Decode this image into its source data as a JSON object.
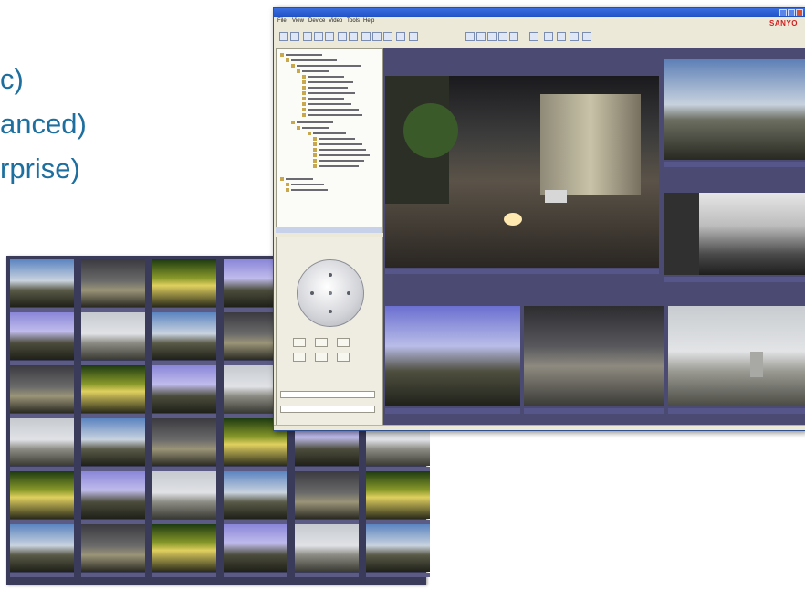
{
  "bullets": [
    {
      "text": "c)"
    },
    {
      "text": "anced)"
    },
    {
      "text": "rprise)"
    }
  ],
  "app": {
    "brand": "SANYO",
    "menu": [
      "File",
      "View",
      "Device",
      "Video",
      "Tools",
      "Help"
    ]
  },
  "colors": {
    "bullet_text": "#1d6f9f",
    "video_background": "#4a4a72",
    "brand_red": "#d02020",
    "titlebar_blue": "#2a5fd6"
  },
  "icons": [
    "window-minimize-icon",
    "window-maximize-icon",
    "close-icon",
    "camera-tree-icon",
    "ptz-control-icon"
  ]
}
